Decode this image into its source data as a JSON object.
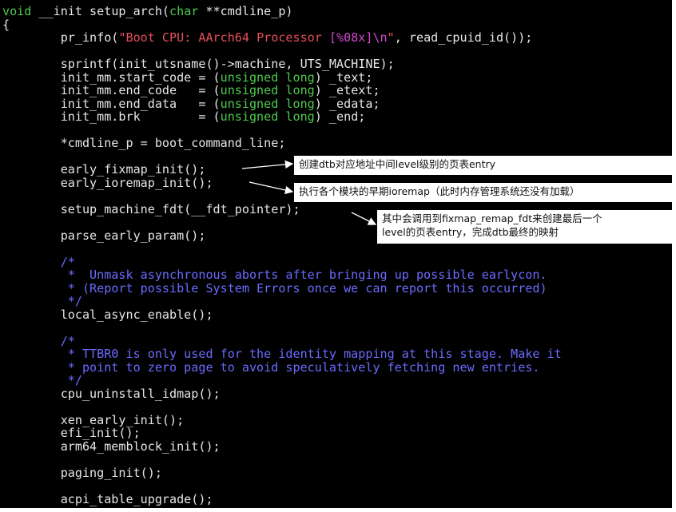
{
  "code_lines": [
    [
      {
        "t": "void",
        "c": "kw"
      },
      {
        "t": " __init setup_arch("
      },
      {
        "t": "char",
        "c": "kw"
      },
      {
        "t": " **cmdline_p)"
      }
    ],
    [
      {
        "t": "{"
      }
    ],
    [
      {
        "t": "        pr_info("
      },
      {
        "t": "\"Boot CPU: AArch64 Processor ",
        "c": "str"
      },
      {
        "t": "[%08x]\\n",
        "c": "esc"
      },
      {
        "t": "\"",
        "c": "str"
      },
      {
        "t": ", read_cpuid_id());"
      }
    ],
    [
      {
        "t": ""
      }
    ],
    [
      {
        "t": "        sprintf(init_utsname()->machine, UTS_MACHINE);"
      }
    ],
    [
      {
        "t": "        init_mm.start_code = ("
      },
      {
        "t": "unsigned long",
        "c": "kw"
      },
      {
        "t": ") _text;"
      }
    ],
    [
      {
        "t": "        init_mm.end_code   = ("
      },
      {
        "t": "unsigned long",
        "c": "kw"
      },
      {
        "t": ") _etext;"
      }
    ],
    [
      {
        "t": "        init_mm.end_data   = ("
      },
      {
        "t": "unsigned long",
        "c": "kw"
      },
      {
        "t": ") _edata;"
      }
    ],
    [
      {
        "t": "        init_mm.brk        = ("
      },
      {
        "t": "unsigned long",
        "c": "kw"
      },
      {
        "t": ") _end;"
      }
    ],
    [
      {
        "t": ""
      }
    ],
    [
      {
        "t": "        *cmdline_p = boot_command_line;"
      }
    ],
    [
      {
        "t": ""
      }
    ],
    [
      {
        "t": "        early_fixmap_init();"
      }
    ],
    [
      {
        "t": "        early_ioremap_init();"
      }
    ],
    [
      {
        "t": ""
      }
    ],
    [
      {
        "t": "        setup_machine_fdt(__fdt_pointer);"
      }
    ],
    [
      {
        "t": ""
      }
    ],
    [
      {
        "t": "        parse_early_param();"
      }
    ],
    [
      {
        "t": ""
      }
    ],
    [
      {
        "t": "        /*",
        "c": "cmt"
      }
    ],
    [
      {
        "t": "         *  Unmask asynchronous aborts after bringing up possible earlycon.",
        "c": "cmt"
      }
    ],
    [
      {
        "t": "         * (Report possible System Errors once we can report this occurred)",
        "c": "cmt"
      }
    ],
    [
      {
        "t": "         */",
        "c": "cmt"
      }
    ],
    [
      {
        "t": "        local_async_enable();"
      }
    ],
    [
      {
        "t": ""
      }
    ],
    [
      {
        "t": "        /*",
        "c": "cmt"
      }
    ],
    [
      {
        "t": "         * TTBR0 is only used for the identity mapping at this stage. Make it",
        "c": "cmt"
      }
    ],
    [
      {
        "t": "         * point to zero page to avoid speculatively fetching new entries.",
        "c": "cmt"
      }
    ],
    [
      {
        "t": "         */",
        "c": "cmt"
      }
    ],
    [
      {
        "t": "        cpu_uninstall_idmap();"
      }
    ],
    [
      {
        "t": ""
      }
    ],
    [
      {
        "t": "        xen_early_init();"
      }
    ],
    [
      {
        "t": "        efi_init();"
      }
    ],
    [
      {
        "t": "        arm64_memblock_init();"
      }
    ],
    [
      {
        "t": ""
      }
    ],
    [
      {
        "t": "        paging_init();"
      }
    ],
    [
      {
        "t": ""
      }
    ],
    [
      {
        "t": "        acpi_table_upgrade();"
      }
    ]
  ],
  "annotations": {
    "fixmap": "创建dtb对应地址中间level级别的页表entry",
    "ioremap": "执行各个模块的早期ioremap（此时内存管理系统还没有加载）",
    "fdt_line1": "其中会调用到fixmap_remap_fdt来创建最后一个",
    "fdt_line2": "level的页表entry，完成dtb最终的映射"
  },
  "colors": {
    "background": "#000000",
    "text": "#e6e6e6",
    "keyword": "#4ec94e",
    "string": "#e8505a",
    "escape": "#d04ad0",
    "comment": "#6b6bff",
    "note_background": "#ffffff"
  }
}
